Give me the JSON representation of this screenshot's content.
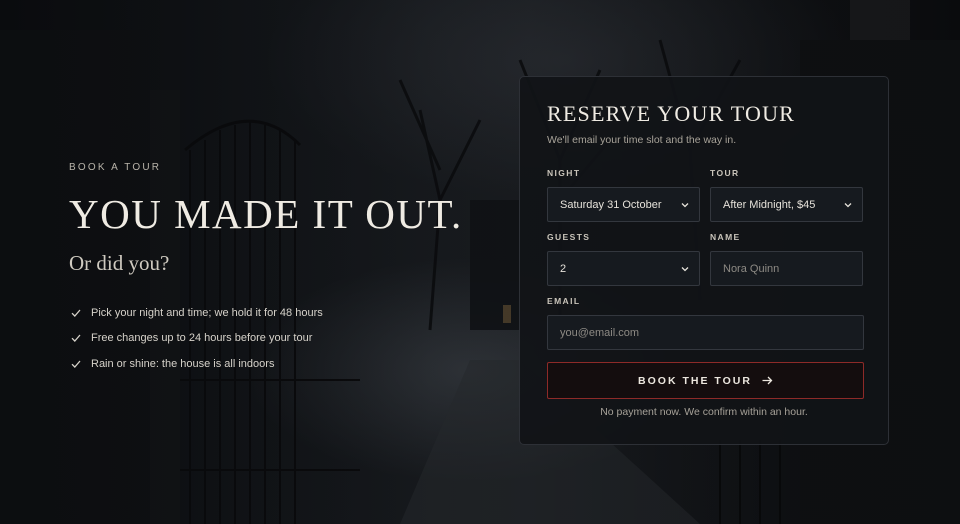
{
  "hero": {
    "eyebrow": "BOOK A TOUR",
    "headline": "YOU MADE IT OUT.",
    "subline": "Or did you?",
    "bullets": [
      "Pick your night and time; we hold it for 48 hours",
      "Free changes up to 24 hours before your tour",
      "Rain or shine: the house is all indoors"
    ]
  },
  "form": {
    "title": "RESERVE YOUR TOUR",
    "subtitle": "We'll email your time slot and the way in.",
    "night": {
      "label": "NIGHT",
      "value": "Saturday 31 October"
    },
    "tour": {
      "label": "TOUR",
      "value": "After Midnight, $45"
    },
    "guests": {
      "label": "GUESTS",
      "value": "2"
    },
    "name": {
      "label": "NAME",
      "placeholder": "Nora Quinn"
    },
    "email": {
      "label": "EMAIL",
      "placeholder": "you@email.com"
    },
    "submit_label": "BOOK THE TOUR",
    "note": "No payment now. We confirm within an hour."
  },
  "icons": {
    "bullet": "check-icon",
    "select": "chevron-down-icon",
    "submit": "arrow-right-icon"
  },
  "colors": {
    "accent_border": "#8e2a28",
    "card_background": "#111317",
    "headline": "#efebe3"
  }
}
